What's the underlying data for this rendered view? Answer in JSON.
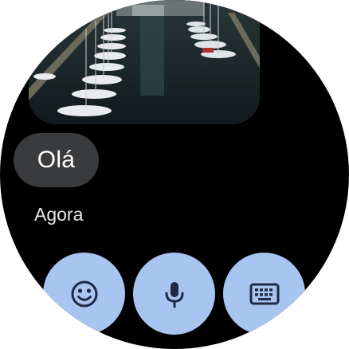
{
  "conversation": {
    "photo_icon": "marina-photo",
    "message_text": "Olá",
    "timestamp": "Agora"
  },
  "reply_actions": [
    {
      "icon": "emoji-icon"
    },
    {
      "icon": "microphone-icon"
    },
    {
      "icon": "keyboard-icon"
    }
  ],
  "colors": {
    "background": "#000000",
    "bubble": "#3a3b3d",
    "action_button": "#a8c4f0",
    "action_icon": "#1f2a44"
  }
}
